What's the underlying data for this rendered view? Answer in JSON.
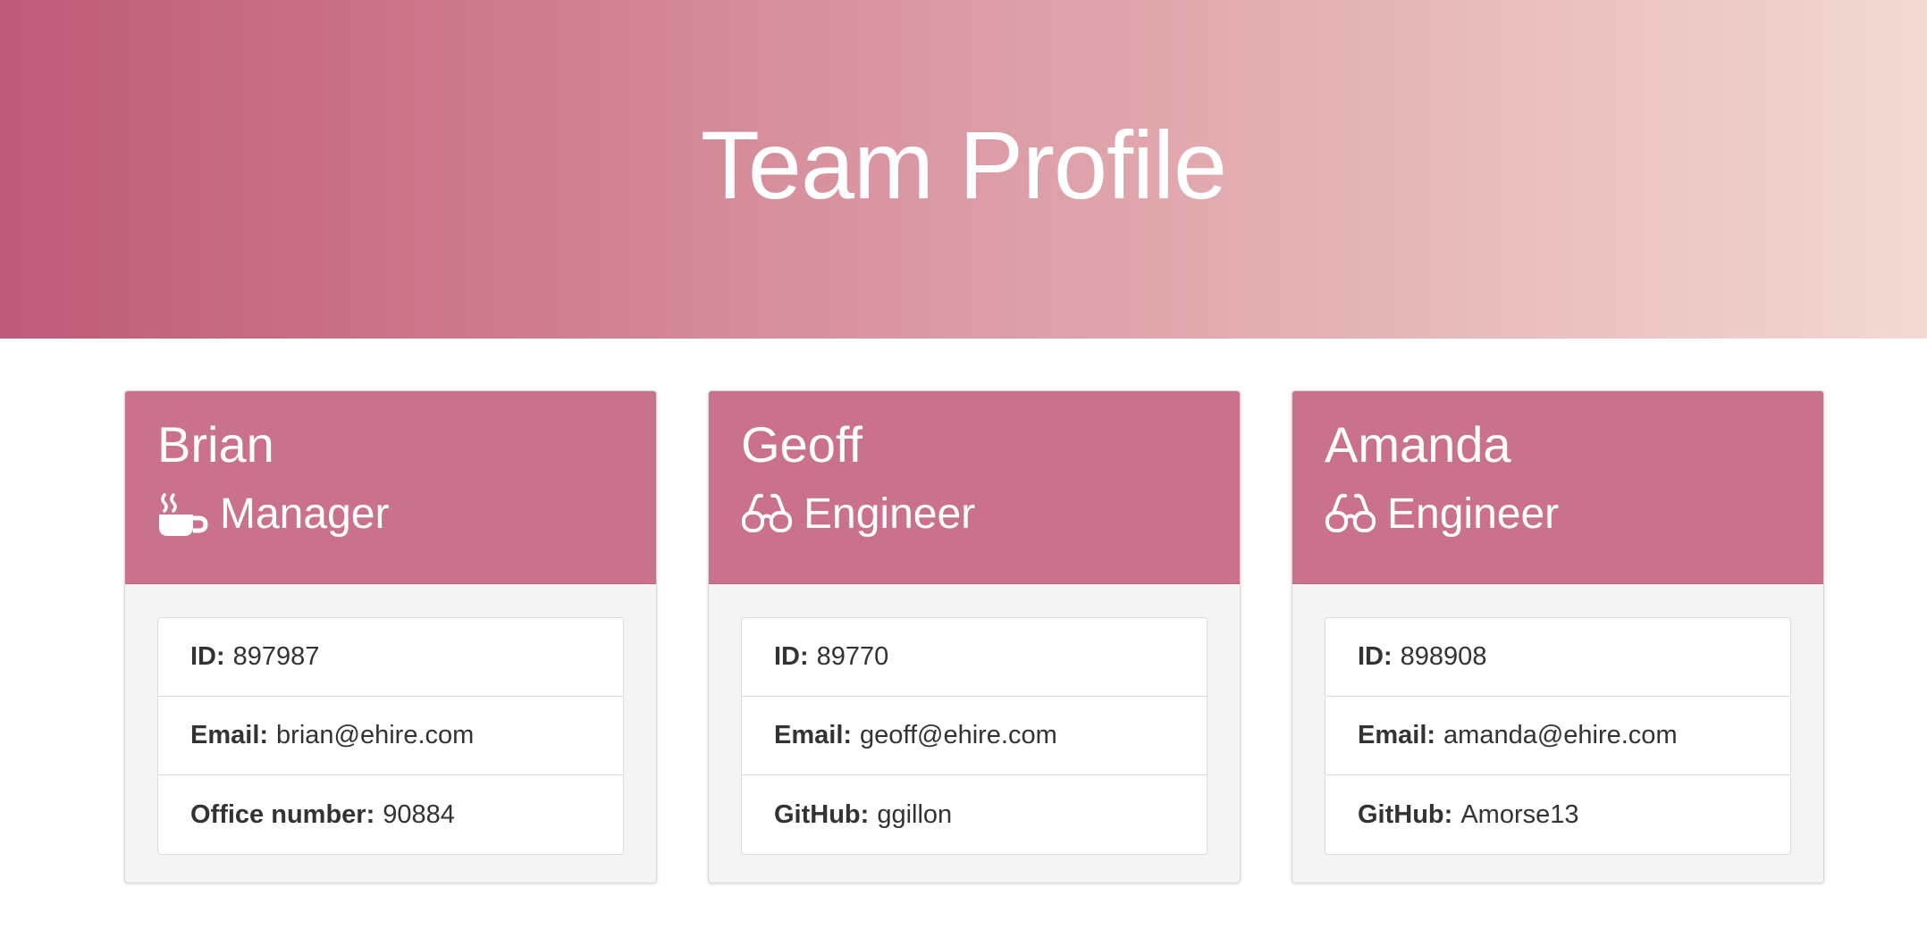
{
  "header": {
    "title": "Team Profile"
  },
  "colors": {
    "accent": "#ca728b",
    "card_body": "#f4f4f4"
  },
  "employees": [
    {
      "name": "Brian",
      "role": "Manager",
      "role_icon": "mug-icon",
      "fields": [
        {
          "label": "ID:",
          "value": "897987"
        },
        {
          "label": "Email:",
          "value": "brian@ehire.com"
        },
        {
          "label": "Office number:",
          "value": "90884"
        }
      ]
    },
    {
      "name": "Geoff",
      "role": "Engineer",
      "role_icon": "glasses-icon",
      "fields": [
        {
          "label": "ID:",
          "value": "89770"
        },
        {
          "label": "Email:",
          "value": "geoff@ehire.com"
        },
        {
          "label": "GitHub:",
          "value": "ggillon"
        }
      ]
    },
    {
      "name": "Amanda",
      "role": "Engineer",
      "role_icon": "glasses-icon",
      "fields": [
        {
          "label": "ID:",
          "value": "898908"
        },
        {
          "label": "Email:",
          "value": "amanda@ehire.com"
        },
        {
          "label": "GitHub:",
          "value": "Amorse13"
        }
      ]
    }
  ]
}
